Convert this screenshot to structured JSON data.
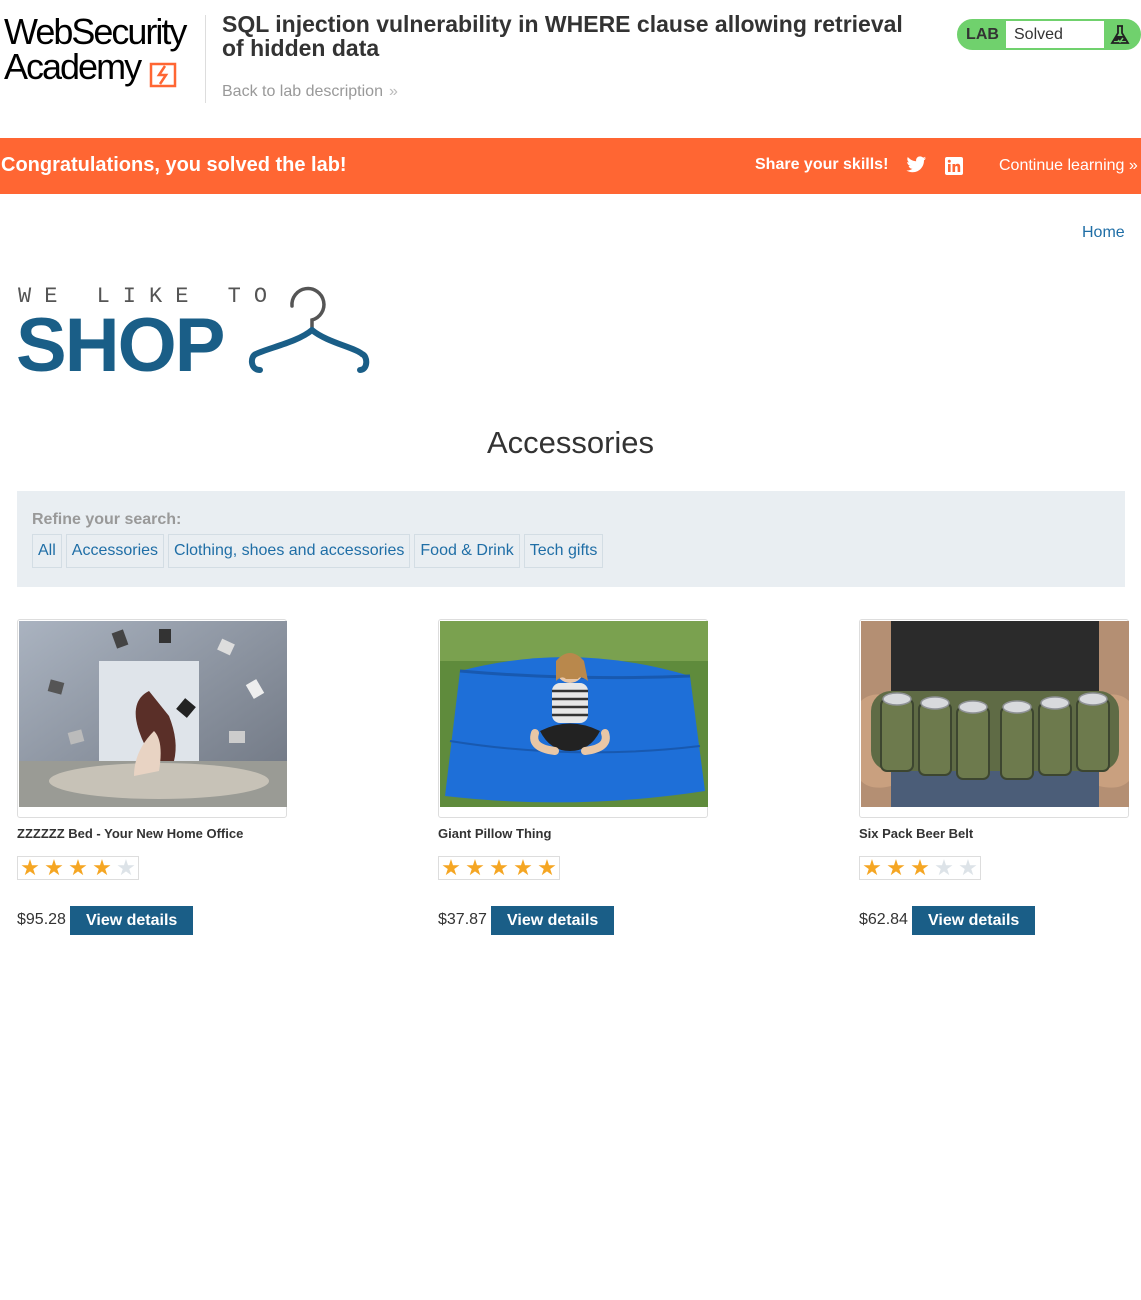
{
  "academy": {
    "logo_line1": "WebSecurity",
    "logo_line2": "Academy",
    "lab_title": "SQL injection vulnerability in WHERE clause allowing retrieval of hidden data",
    "back_link": "Back to lab description",
    "status_label": "LAB",
    "status_value": "Solved",
    "colors": {
      "accent": "#ff6633",
      "solved": "#70d16d"
    }
  },
  "banner": {
    "message": "Congratulations, you solved the lab!",
    "share_label": "Share your skills!",
    "twitter_icon": "twitter-icon",
    "linkedin_icon": "linkedin-icon",
    "continue_label": "Continue learning"
  },
  "shop": {
    "nav_home": "Home",
    "logo_tagline": "WE LIKE TO",
    "logo_word": "SHOP",
    "page_heading": "Accessories",
    "refine_label": "Refine your search:",
    "filters": [
      "All",
      "Accessories",
      "Clothing, shoes and accessories",
      "Food & Drink",
      "Tech gifts"
    ],
    "view_label": "View details",
    "products": [
      {
        "name": "ZZZZZZ Bed - Your New Home Office",
        "price": "$95.28",
        "rating": 4
      },
      {
        "name": "Giant Pillow Thing",
        "price": "$37.87",
        "rating": 5
      },
      {
        "name": "Six Pack Beer Belt",
        "price": "$62.84",
        "rating": 3
      }
    ],
    "rating_max": 5,
    "colors": {
      "brand": "#1a5e87",
      "link": "#1f6ea6",
      "star": "#f5a623"
    }
  }
}
